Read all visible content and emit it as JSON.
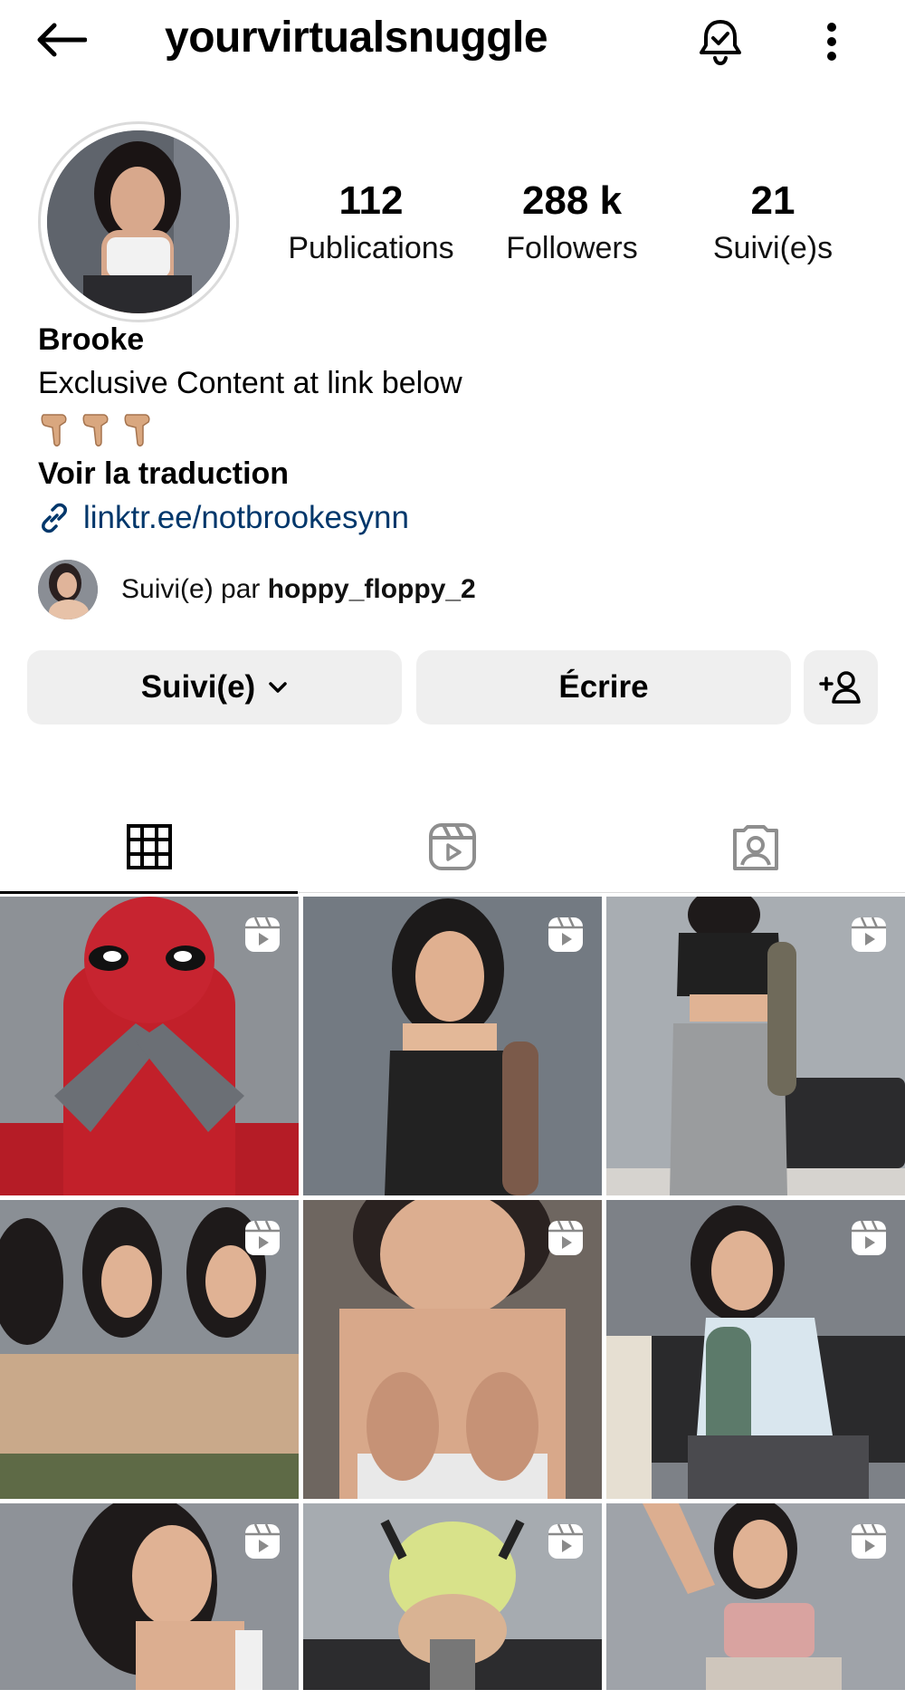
{
  "header": {
    "back_icon": "arrow-left-icon",
    "username": "yourvirtualsnuggle",
    "notify_icon": "bell-check-icon",
    "more_icon": "more-vertical-icon"
  },
  "profile": {
    "stats": [
      {
        "value": "112",
        "label": "Publications"
      },
      {
        "value": "288 k",
        "label": "Followers"
      },
      {
        "value": "21",
        "label": "Suivi(e)s"
      }
    ],
    "name": "Brooke",
    "bio": "Exclusive Content at link below",
    "emoji_count": 3,
    "translate": "Voir la traduction",
    "link": "linktr.ee/notbrookesynn",
    "followed_by_prefix": "Suivi(e) par ",
    "followed_by_user": "hoppy_floppy_2"
  },
  "actions": {
    "follow_label": "Suivi(e)",
    "message_label": "Écrire",
    "add_icon": "person-add-icon"
  },
  "tabs": [
    {
      "name": "grid",
      "icon": "grid-icon",
      "active": true
    },
    {
      "name": "reels",
      "icon": "reels-icon",
      "active": false
    },
    {
      "name": "tagged",
      "icon": "tagged-icon",
      "active": false
    }
  ],
  "grid": {
    "columns": 3,
    "rows": 3,
    "badge_icon": "reels-icon",
    "colors": {
      "accent_link": "#00376b",
      "button_bg": "#efefef"
    }
  }
}
